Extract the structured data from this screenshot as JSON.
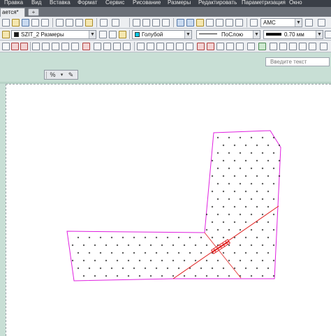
{
  "menu": [
    "Правка",
    "Вид",
    "Вставка",
    "Формат",
    "Сервис",
    "Рисование",
    "Размеры",
    "Редактировать",
    "Параметризация",
    "Окно"
  ],
  "tabs": {
    "document": "ается*",
    "new_tab": "+"
  },
  "toolbar2": {
    "layer": "SZIT_2 Размеры",
    "color": "Голубой",
    "linetype": "ПоСлою",
    "lineweight": "0.70 мм"
  },
  "toolbar1": {
    "textstyle": "AMC"
  },
  "search": {
    "placeholder": "Введите текст"
  },
  "colors": {
    "outline": "#e020e0",
    "section_line": "#e02020",
    "hatch": "#202020",
    "model_bg": "#c8dfd5"
  },
  "icons": [
    "percent-icon",
    "edit-icon"
  ]
}
